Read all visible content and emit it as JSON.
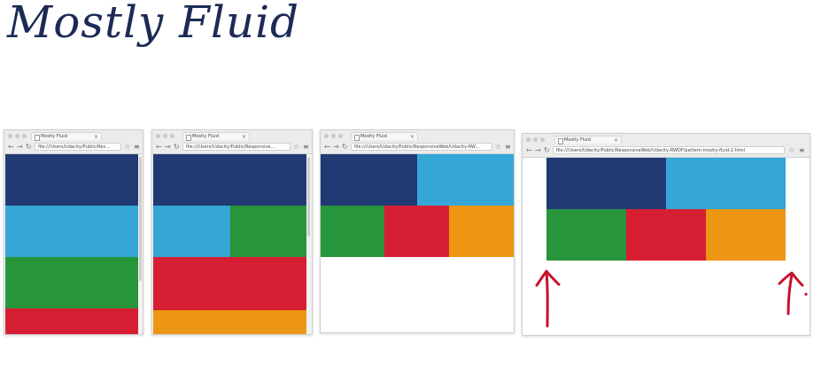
{
  "title": "Mostly Fluid",
  "colors": {
    "dark_blue": "#223a73",
    "light_blue": "#34a7d6",
    "green": "#27963b",
    "red": "#d71f33",
    "orange": "#ec9613",
    "arrow_red": "#c8102e"
  },
  "windows": [
    {
      "tab_title": "Mostly Fluid",
      "url": "file:///Users/Udacity/Public/Res..."
    },
    {
      "tab_title": "Mostly Fluid",
      "url": "file:///Users/Udacity/Public/Responsive..."
    },
    {
      "tab_title": "Mostly Fluid",
      "url": "file:///Users/Udacity/Public/ResponsiveWeb/Udacity-RW..."
    },
    {
      "tab_title": "Mostly Fluid",
      "url": "file:///Users/Udacity/Public/ResponsiveWeb/Udacity-RWDF/pattern-mostly-fluid-2.html"
    }
  ],
  "icons": {
    "back": "←",
    "forward": "→",
    "reload": "↻",
    "star": "☆",
    "menu": "≡",
    "close": "×"
  }
}
